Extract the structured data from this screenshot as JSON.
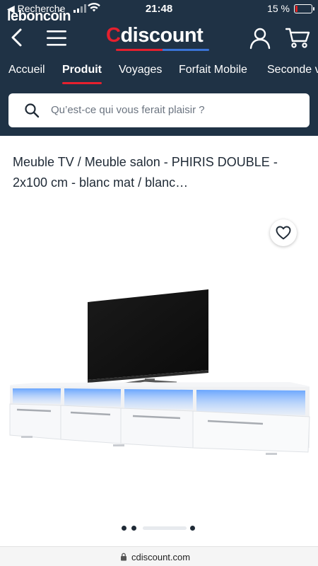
{
  "status_bar": {
    "back_app": "◀ Recherche",
    "time": "21:48",
    "battery": "15 %",
    "battery_level": 0.15
  },
  "overlay_logo": "leboncoin",
  "header": {
    "logo": {
      "first_letter": "C",
      "rest": "discount"
    },
    "nav_tabs": [
      {
        "label": "Accueil",
        "active": false
      },
      {
        "label": "Produit",
        "active": true
      },
      {
        "label": "Voyages",
        "active": false
      },
      {
        "label": "Forfait Mobile",
        "active": false
      },
      {
        "label": "Seconde v",
        "active": false
      }
    ],
    "search": {
      "placeholder": "Qu’est-ce qui vous ferait plaisir ?"
    }
  },
  "product": {
    "title": "Meuble TV / Meuble salon - PHIRIS DOUBLE - 2x100 cm - blanc mat / blanc…",
    "image_alt": "Meuble TV blanc avec éclairage LED bleu et téléviseur"
  },
  "carousel": {
    "total": 4,
    "current": 3
  },
  "browser": {
    "url": "cdiscount.com"
  },
  "colors": {
    "header_bg": "#1f3245",
    "accent_red": "#e5202e",
    "accent_blue": "#3a73d6",
    "led_blue": "#5a9dff"
  },
  "icons": [
    "back-icon",
    "menu-icon",
    "user-icon",
    "cart-icon",
    "search-icon",
    "heart-icon",
    "lock-icon"
  ]
}
